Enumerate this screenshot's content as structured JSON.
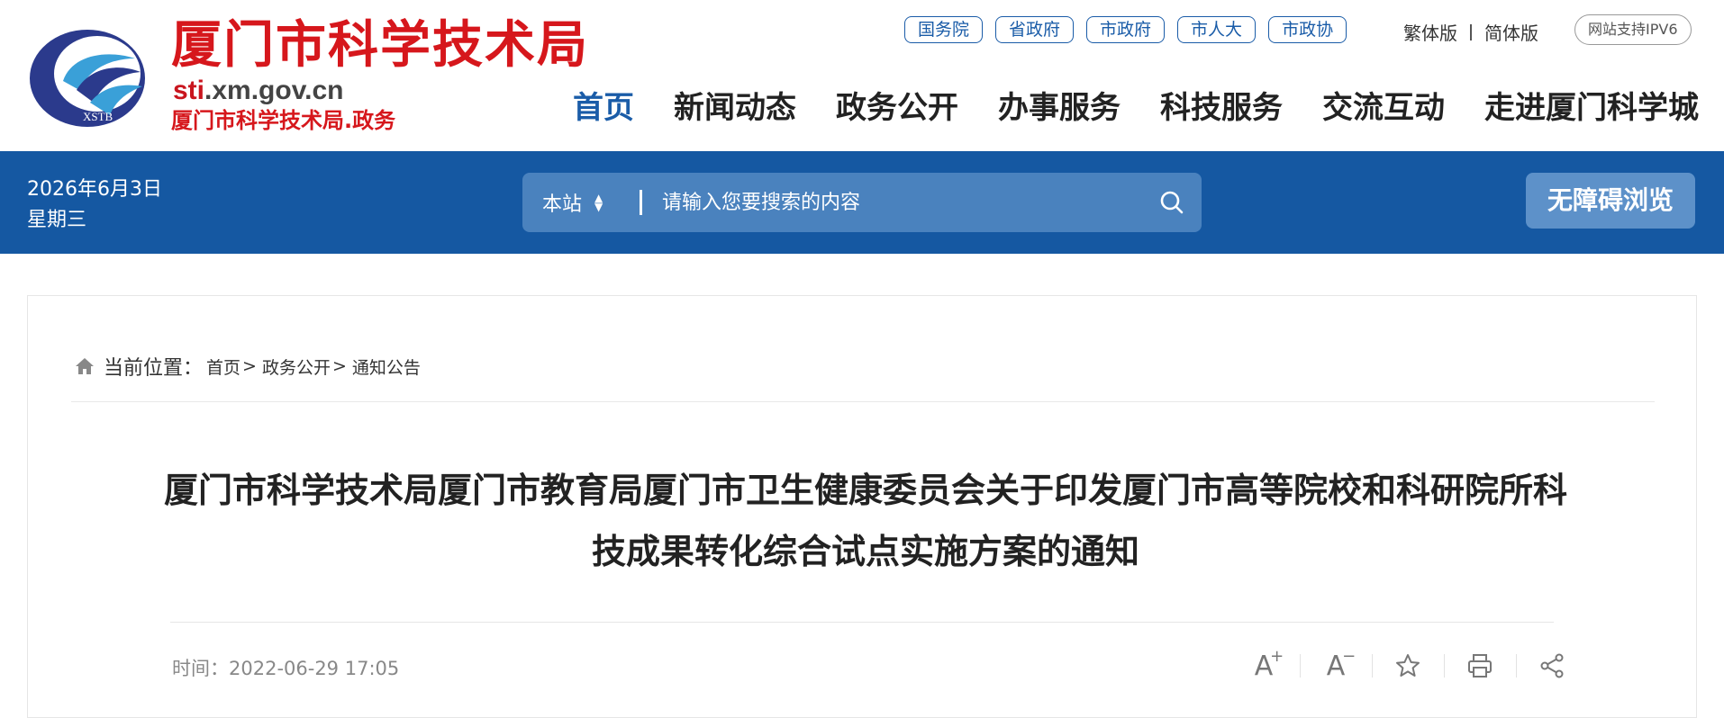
{
  "header": {
    "site_name": "厦门市科学技术局",
    "domain_prefix": "sti",
    "domain_rest": ".xm.gov.cn",
    "site_subtitle": "厦门市科学技术局.政务",
    "logo_text": "XSTB",
    "gov_links": [
      "国务院",
      "省政府",
      "市政府",
      "市人大",
      "市政协"
    ],
    "lang_traditional": "繁体版",
    "lang_simplified": "简体版",
    "ipv6_badge": "网站支持IPV6",
    "nav": [
      "首页",
      "新闻动态",
      "政务公开",
      "办事服务",
      "科技服务",
      "交流互动",
      "走进厦门科学城"
    ],
    "nav_active": "首页"
  },
  "bluebar": {
    "date": "2026年6月3日",
    "weekday": "星期三",
    "search_scope": "本站",
    "search_placeholder": "请输入您要搜索的内容",
    "accessibility_label": "无障碍浏览"
  },
  "content": {
    "breadcrumb_label": "当前位置：",
    "breadcrumb": [
      "首页",
      "政务公开",
      "通知公告"
    ],
    "breadcrumb_sep": ">",
    "title": "厦门市科学技术局厦门市教育局厦门市卫生健康委员会关于印发厦门市高等院校和科研院所科技成果转化综合试点实施方案的通知",
    "time_label": "时间：",
    "time_value": "2022-06-29 17:05",
    "tools": [
      "font-increase-icon",
      "font-decrease-icon",
      "star-icon",
      "print-icon",
      "share-icon"
    ]
  },
  "colors": {
    "brand_red": "#d6171c",
    "brand_blue": "#1558a2",
    "search_bg": "#4a82be",
    "accessibility_bg": "#5d91c9"
  }
}
